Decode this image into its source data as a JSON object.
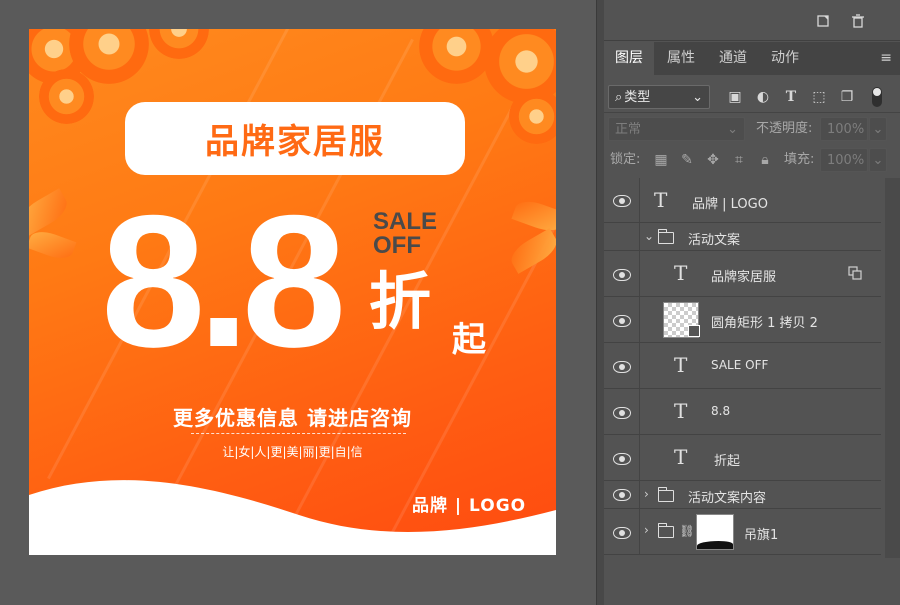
{
  "artboard": {
    "brand_title": "品牌家居服",
    "big_number": "8.8",
    "sale_line1": "SALE",
    "sale_line2": "OFF",
    "zhe": "折",
    "qi": "起",
    "promo": "更多优惠信息 请进店咨询",
    "slogan": "让|女|人|更|美|丽|更|自|信",
    "logo": "品牌 | LOGO",
    "colors": {
      "orange": "#ff7a14",
      "text_dark": "#4a4a4a",
      "white": "#ffffff"
    }
  },
  "panel": {
    "tabs": [
      "图层",
      "属性",
      "通道",
      "动作"
    ],
    "active_tab": "图层",
    "filter_kind": "类型",
    "blend_mode": "正常",
    "opacity_label": "不透明度:",
    "opacity_value": "100%",
    "lock_label": "锁定:",
    "fill_label": "填充:",
    "fill_value": "100%",
    "layers": [
      {
        "type": "text",
        "name": "品牌 | LOGO",
        "indent": 0
      },
      {
        "type": "group",
        "name": "活动文案",
        "expanded": true,
        "indent": 0
      },
      {
        "type": "text",
        "name": "品牌家居服",
        "indent": 1,
        "linked": true
      },
      {
        "type": "shape",
        "name": "圆角矩形 1 拷贝 2",
        "indent": 1
      },
      {
        "type": "text",
        "name": "SALE OFF",
        "indent": 1
      },
      {
        "type": "text",
        "name": "8.8",
        "indent": 1
      },
      {
        "type": "text",
        "name": "折起",
        "indent": 1
      },
      {
        "type": "group",
        "name": "活动文案内容",
        "expanded": false,
        "indent": 0
      },
      {
        "type": "group-mask",
        "name": "吊旗1",
        "expanded": false,
        "indent": 0
      }
    ]
  }
}
